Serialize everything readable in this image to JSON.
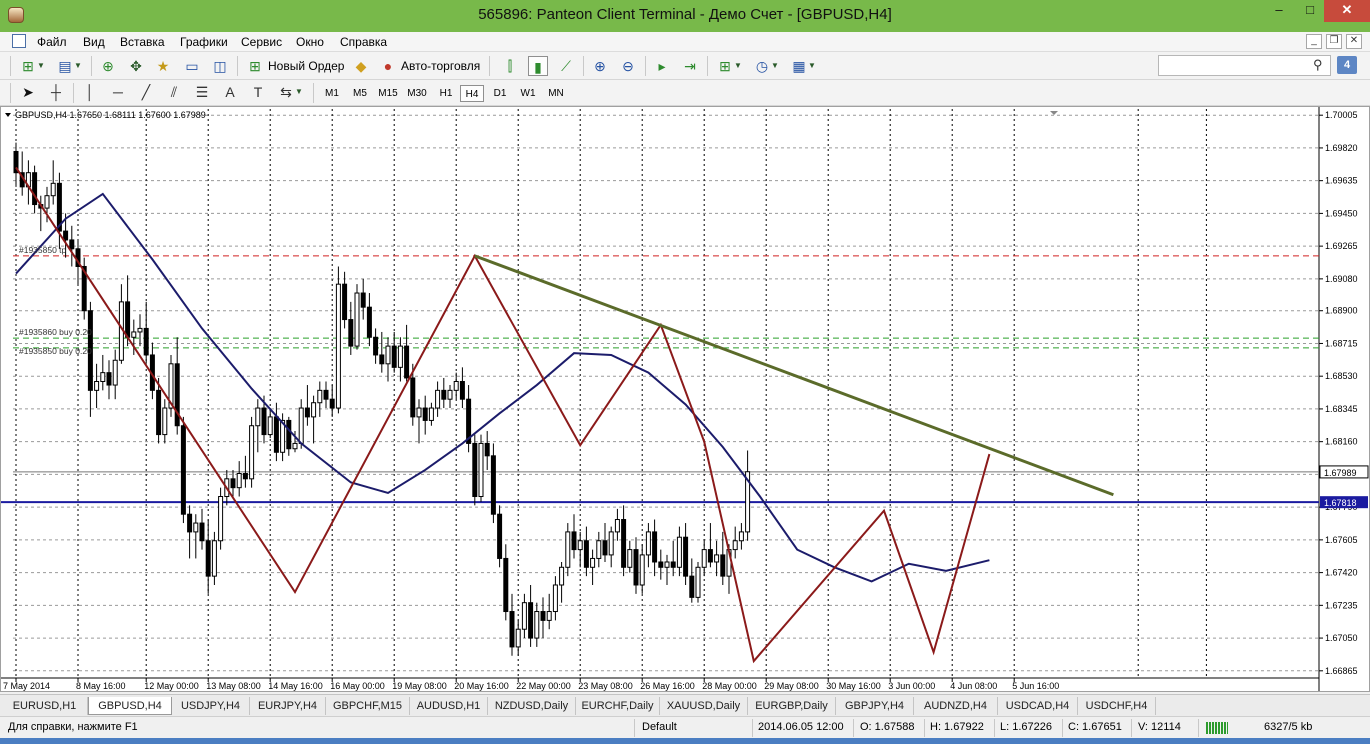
{
  "window": {
    "title": "565896: Panteon Client Terminal - Демо Счет - [GBPUSD,H4]",
    "min_label": "–",
    "max_label": "□",
    "close_label": "✕"
  },
  "menu": {
    "items": [
      "Файл",
      "Вид",
      "Вставка",
      "Графики",
      "Сервис",
      "Окно",
      "Справка"
    ],
    "mdi_min": "_",
    "mdi_restore": "❐",
    "mdi_close": "✕"
  },
  "toolbar": {
    "new_order_label": "Новый Ордер",
    "autotrading_label": "Авто-торговля",
    "search_placeholder": "",
    "msg_count": "4",
    "timeframes": [
      "M1",
      "M5",
      "M15",
      "M30",
      "H1",
      "H4",
      "D1",
      "W1",
      "MN"
    ],
    "active_timeframe": "H4",
    "text_tool": "A",
    "label_tool": "T"
  },
  "chart_data": {
    "type": "candlestick",
    "symbol_header": "GBPUSD,H4  1.67650 1.68111 1.67600 1.67989",
    "y_ticks": [
      "1.70005",
      "1.69820",
      "1.69635",
      "1.69450",
      "1.69265",
      "1.69080",
      "1.68900",
      "1.68715",
      "1.68530",
      "1.68345",
      "1.68160",
      "1.67975",
      "1.67790",
      "1.67605",
      "1.67420",
      "1.67235",
      "1.67050",
      "1.66865"
    ],
    "y_tick_values": [
      1.70005,
      1.6982,
      1.69635,
      1.6945,
      1.69265,
      1.6908,
      1.689,
      1.68715,
      1.6853,
      1.68345,
      1.6816,
      1.67975,
      1.6779,
      1.67605,
      1.6742,
      1.67235,
      1.6705,
      1.66865
    ],
    "ylim": [
      1.6683,
      1.7004
    ],
    "x_ticks": [
      "7 May 2014",
      "8 May 16:00",
      "12 May 00:00",
      "13 May 08:00",
      "14 May 16:00",
      "16 May 00:00",
      "19 May 08:00",
      "20 May 16:00",
      "22 May 00:00",
      "23 May 08:00",
      "26 May 16:00",
      "28 May 00:00",
      "29 May 08:00",
      "30 May 16:00",
      "3 Jun 00:00",
      "4 Jun 08:00",
      "5 Jun 16:00"
    ],
    "x_tick_bars": [
      0,
      10,
      21,
      31,
      41,
      51,
      61,
      71,
      81,
      91,
      101,
      111,
      121,
      131,
      141,
      151,
      161
    ],
    "current_price": "1.67989",
    "current_price_value": 1.67989,
    "hline_price": "1.67818",
    "hline_price_value": 1.67818,
    "order_labels": [
      "#1935850 tp",
      "#1935860 buy 0.20",
      "#1935850 buy 0.20"
    ],
    "order_levels": [
      1.6921,
      1.68745,
      1.6869
    ],
    "zigzag": [
      [
        0,
        1.6971
      ],
      [
        45,
        1.6731
      ],
      [
        74,
        1.6921
      ],
      [
        104,
        1.6882
      ],
      [
        91,
        1.6814
      ],
      [
        111,
        1.6816
      ],
      [
        119,
        1.6692
      ],
      [
        140,
        1.6777
      ],
      [
        148,
        1.6697
      ],
      [
        157,
        1.6809
      ]
    ],
    "trendline": [
      [
        74,
        1.6921
      ],
      [
        177,
        1.6786
      ]
    ],
    "ma": [
      [
        0,
        1.6911
      ],
      [
        8,
        1.6942
      ],
      [
        14,
        1.6956
      ],
      [
        22,
        1.6919
      ],
      [
        30,
        1.688
      ],
      [
        38,
        1.6846
      ],
      [
        46,
        1.6815
      ],
      [
        54,
        1.6793
      ],
      [
        60,
        1.6787
      ],
      [
        66,
        1.68
      ],
      [
        72,
        1.6815
      ],
      [
        78,
        1.6832
      ],
      [
        84,
        1.6848
      ],
      [
        90,
        1.6866
      ],
      [
        96,
        1.6865
      ],
      [
        102,
        1.6855
      ],
      [
        108,
        1.6837
      ],
      [
        114,
        1.6813
      ],
      [
        120,
        1.6785
      ],
      [
        126,
        1.6755
      ],
      [
        132,
        1.6745
      ],
      [
        138,
        1.6737
      ],
      [
        144,
        1.6747
      ],
      [
        150,
        1.6743
      ],
      [
        157,
        1.6749
      ]
    ],
    "bars": [
      [
        1.698,
        1.6985,
        1.696,
        1.6968
      ],
      [
        1.6968,
        1.698,
        1.6955,
        1.696
      ],
      [
        1.696,
        1.6975,
        1.695,
        1.6968
      ],
      [
        1.6968,
        1.6972,
        1.6945,
        1.695
      ],
      [
        1.695,
        1.6955,
        1.6935,
        1.6948
      ],
      [
        1.6948,
        1.696,
        1.694,
        1.6955
      ],
      [
        1.6955,
        1.6975,
        1.695,
        1.6962
      ],
      [
        1.6962,
        1.6968,
        1.6925,
        1.6935
      ],
      [
        1.6935,
        1.6945,
        1.692,
        1.693
      ],
      [
        1.693,
        1.6938,
        1.6915,
        1.6925
      ],
      [
        1.6925,
        1.693,
        1.6905,
        1.6915
      ],
      [
        1.6915,
        1.692,
        1.6885,
        1.689
      ],
      [
        1.689,
        1.6895,
        1.683,
        1.6845
      ],
      [
        1.6845,
        1.686,
        1.6835,
        1.685
      ],
      [
        1.685,
        1.6865,
        1.6845,
        1.6855
      ],
      [
        1.6855,
        1.6862,
        1.684,
        1.6848
      ],
      [
        1.6848,
        1.6868,
        1.684,
        1.6862
      ],
      [
        1.6862,
        1.6905,
        1.686,
        1.6895
      ],
      [
        1.6895,
        1.691,
        1.687,
        1.6875
      ],
      [
        1.6875,
        1.6885,
        1.6865,
        1.6878
      ],
      [
        1.6878,
        1.6888,
        1.687,
        1.688
      ],
      [
        1.688,
        1.6895,
        1.686,
        1.6865
      ],
      [
        1.6865,
        1.6872,
        1.684,
        1.6845
      ],
      [
        1.6845,
        1.6852,
        1.6815,
        1.682
      ],
      [
        1.682,
        1.684,
        1.6815,
        1.6835
      ],
      [
        1.6835,
        1.6865,
        1.683,
        1.686
      ],
      [
        1.686,
        1.6875,
        1.682,
        1.6825
      ],
      [
        1.6825,
        1.683,
        1.677,
        1.6775
      ],
      [
        1.6775,
        1.678,
        1.675,
        1.6765
      ],
      [
        1.6765,
        1.6775,
        1.675,
        1.677
      ],
      [
        1.677,
        1.6778,
        1.6755,
        1.676
      ],
      [
        1.676,
        1.6772,
        1.673,
        1.674
      ],
      [
        1.674,
        1.6765,
        1.6735,
        1.676
      ],
      [
        1.676,
        1.679,
        1.6755,
        1.6785
      ],
      [
        1.6785,
        1.68,
        1.678,
        1.6795
      ],
      [
        1.6795,
        1.68,
        1.6785,
        1.679
      ],
      [
        1.679,
        1.6805,
        1.6785,
        1.6798
      ],
      [
        1.6798,
        1.6808,
        1.679,
        1.6795
      ],
      [
        1.6795,
        1.683,
        1.679,
        1.6825
      ],
      [
        1.6825,
        1.684,
        1.681,
        1.6835
      ],
      [
        1.6835,
        1.6842,
        1.6815,
        1.682
      ],
      [
        1.682,
        1.6835,
        1.6818,
        1.683
      ],
      [
        1.683,
        1.6838,
        1.6805,
        1.681
      ],
      [
        1.681,
        1.6832,
        1.6805,
        1.6828
      ],
      [
        1.6828,
        1.683,
        1.6808,
        1.6812
      ],
      [
        1.6812,
        1.6822,
        1.681,
        1.6815
      ],
      [
        1.6815,
        1.684,
        1.6812,
        1.6835
      ],
      [
        1.6835,
        1.6848,
        1.6825,
        1.683
      ],
      [
        1.683,
        1.6842,
        1.6815,
        1.6838
      ],
      [
        1.6838,
        1.685,
        1.683,
        1.6845
      ],
      [
        1.6845,
        1.685,
        1.6835,
        1.684
      ],
      [
        1.684,
        1.6848,
        1.683,
        1.6835
      ],
      [
        1.6835,
        1.6915,
        1.6832,
        1.6905
      ],
      [
        1.6905,
        1.6912,
        1.688,
        1.6885
      ],
      [
        1.6885,
        1.6895,
        1.6865,
        1.687
      ],
      [
        1.687,
        1.6905,
        1.6868,
        1.69
      ],
      [
        1.69,
        1.6908,
        1.6885,
        1.6892
      ],
      [
        1.6892,
        1.69,
        1.687,
        1.6875
      ],
      [
        1.6875,
        1.688,
        1.686,
        1.6865
      ],
      [
        1.6865,
        1.6878,
        1.6855,
        1.686
      ],
      [
        1.686,
        1.6875,
        1.685,
        1.687
      ],
      [
        1.687,
        1.6878,
        1.6855,
        1.6858
      ],
      [
        1.6858,
        1.6875,
        1.685,
        1.687
      ],
      [
        1.687,
        1.6882,
        1.685,
        1.6852
      ],
      [
        1.6852,
        1.686,
        1.6825,
        1.683
      ],
      [
        1.683,
        1.684,
        1.6815,
        1.6835
      ],
      [
        1.6835,
        1.6842,
        1.682,
        1.6828
      ],
      [
        1.6828,
        1.6838,
        1.6825,
        1.6835
      ],
      [
        1.6835,
        1.685,
        1.683,
        1.6845
      ],
      [
        1.6845,
        1.6852,
        1.6835,
        1.684
      ],
      [
        1.684,
        1.6848,
        1.6835,
        1.6845
      ],
      [
        1.6845,
        1.6855,
        1.684,
        1.685
      ],
      [
        1.685,
        1.6858,
        1.6835,
        1.684
      ],
      [
        1.684,
        1.6848,
        1.681,
        1.6815
      ],
      [
        1.6815,
        1.682,
        1.678,
        1.6785
      ],
      [
        1.6785,
        1.682,
        1.6782,
        1.6815
      ],
      [
        1.6815,
        1.6822,
        1.68,
        1.6808
      ],
      [
        1.6808,
        1.6815,
        1.677,
        1.6775
      ],
      [
        1.6775,
        1.678,
        1.6745,
        1.675
      ],
      [
        1.675,
        1.6758,
        1.6715,
        1.672
      ],
      [
        1.672,
        1.673,
        1.6695,
        1.67
      ],
      [
        1.67,
        1.6715,
        1.6695,
        1.671
      ],
      [
        1.671,
        1.673,
        1.6705,
        1.6725
      ],
      [
        1.6725,
        1.6735,
        1.67,
        1.6705
      ],
      [
        1.6705,
        1.6725,
        1.67,
        1.672
      ],
      [
        1.672,
        1.6728,
        1.6705,
        1.6715
      ],
      [
        1.6715,
        1.673,
        1.671,
        1.672
      ],
      [
        1.672,
        1.674,
        1.6715,
        1.6735
      ],
      [
        1.6735,
        1.6748,
        1.6725,
        1.6745
      ],
      [
        1.6745,
        1.677,
        1.674,
        1.6765
      ],
      [
        1.6765,
        1.6775,
        1.675,
        1.6755
      ],
      [
        1.6755,
        1.6765,
        1.6745,
        1.676
      ],
      [
        1.676,
        1.6768,
        1.674,
        1.6745
      ],
      [
        1.6745,
        1.6755,
        1.6735,
        1.675
      ],
      [
        1.675,
        1.6765,
        1.6745,
        1.676
      ],
      [
        1.676,
        1.677,
        1.6748,
        1.6752
      ],
      [
        1.6752,
        1.6768,
        1.6745,
        1.6765
      ],
      [
        1.6765,
        1.6778,
        1.676,
        1.6772
      ],
      [
        1.6772,
        1.678,
        1.674,
        1.6745
      ],
      [
        1.6745,
        1.676,
        1.6742,
        1.6755
      ],
      [
        1.6755,
        1.6762,
        1.673,
        1.6735
      ],
      [
        1.6735,
        1.6758,
        1.673,
        1.6752
      ],
      [
        1.6752,
        1.677,
        1.6745,
        1.6765
      ],
      [
        1.6765,
        1.6772,
        1.674,
        1.6748
      ],
      [
        1.6748,
        1.6755,
        1.6738,
        1.6745
      ],
      [
        1.6745,
        1.6752,
        1.6735,
        1.6748
      ],
      [
        1.6748,
        1.676,
        1.674,
        1.6745
      ],
      [
        1.6745,
        1.6768,
        1.674,
        1.6762
      ],
      [
        1.6762,
        1.677,
        1.6735,
        1.674
      ],
      [
        1.674,
        1.675,
        1.6725,
        1.6728
      ],
      [
        1.6728,
        1.6748,
        1.6725,
        1.6745
      ],
      [
        1.6745,
        1.676,
        1.674,
        1.6755
      ],
      [
        1.6755,
        1.677,
        1.6745,
        1.6748
      ],
      [
        1.6748,
        1.676,
        1.674,
        1.6752
      ],
      [
        1.6752,
        1.6765,
        1.6735,
        1.674
      ],
      [
        1.674,
        1.6758,
        1.673,
        1.6755
      ],
      [
        1.6755,
        1.6768,
        1.675,
        1.676
      ],
      [
        1.676,
        1.677,
        1.6755,
        1.6765
      ],
      [
        1.6765,
        1.6811,
        1.676,
        1.6799
      ]
    ]
  },
  "tabs": [
    "EURUSD,H1",
    "GBPUSD,H4",
    "USDJPY,H4",
    "EURJPY,H4",
    "GBPCHF,M15",
    "AUDUSD,H1",
    "NZDUSD,Daily",
    "EURCHF,Daily",
    "XAUUSD,Daily",
    "EURGBP,Daily",
    "GBPJPY,H4",
    "AUDNZD,H4",
    "USDCAD,H4",
    "USDCHF,H4"
  ],
  "active_tab": "GBPUSD,H4",
  "status": {
    "help": "Для справки, нажмите F1",
    "profile": "Default",
    "datetime": "2014.06.05 12:00",
    "open": "O: 1.67588",
    "high": "H: 1.67922",
    "low": "L: 1.67226",
    "close": "C: 1.67651",
    "volume": "V: 12114",
    "traffic": "6327/5 kb"
  },
  "colors": {
    "title_bar": "#78b94a",
    "candle": "#000000",
    "zigzag": "#8b1a1a",
    "trendline": "#5b6b2a",
    "ma": "#1c1c6b",
    "price_hline": "#1b1ba0",
    "tp_line": "#d22222",
    "order_line": "#2aa02a"
  }
}
